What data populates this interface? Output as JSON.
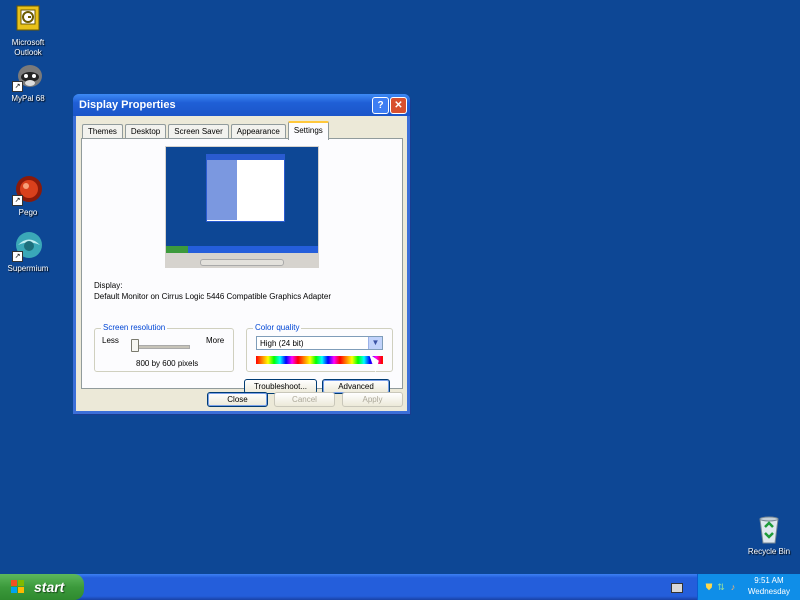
{
  "desktop": {
    "icons": [
      {
        "label_line1": "Microsoft",
        "label_line2": "Outlook",
        "icon": "outlook-icon"
      },
      {
        "label_line1": "MyPal 68",
        "label_line2": "",
        "icon": "mypal-icon"
      },
      {
        "label_line1": "Pego",
        "label_line2": "",
        "icon": "pego-icon"
      },
      {
        "label_line1": "Supermium",
        "label_line2": "",
        "icon": "supermium-icon"
      },
      {
        "label_line1": "Recycle Bin",
        "label_line2": "",
        "icon": "recycle-bin-icon"
      }
    ]
  },
  "window": {
    "title": "Display Properties",
    "help_glyph": "?",
    "close_glyph": "✕",
    "tabs": [
      "Themes",
      "Desktop",
      "Screen Saver",
      "Appearance",
      "Settings"
    ],
    "active_tab": "Settings",
    "display_label": "Display:",
    "display_value": "Default Monitor on Cirrus Logic 5446 Compatible Graphics Adapter",
    "resolution": {
      "title": "Screen resolution",
      "less": "Less",
      "more": "More",
      "value": "800 by 600 pixels"
    },
    "color_quality": {
      "title": "Color quality",
      "selected": "High (24 bit)",
      "arrow": "▼"
    },
    "buttons": {
      "troubleshoot": "Troubleshoot...",
      "advanced": "Advanced",
      "close": "Close",
      "cancel": "Cancel",
      "apply": "Apply"
    }
  },
  "taskbar": {
    "start_label": "start",
    "clock_time": "9:51 AM",
    "clock_day": "Wednesday"
  },
  "colors": {
    "desktop": "#0d4795",
    "taskbar": "#245edb",
    "start": "#3c9a3c",
    "tray": "#0f8ee8"
  }
}
